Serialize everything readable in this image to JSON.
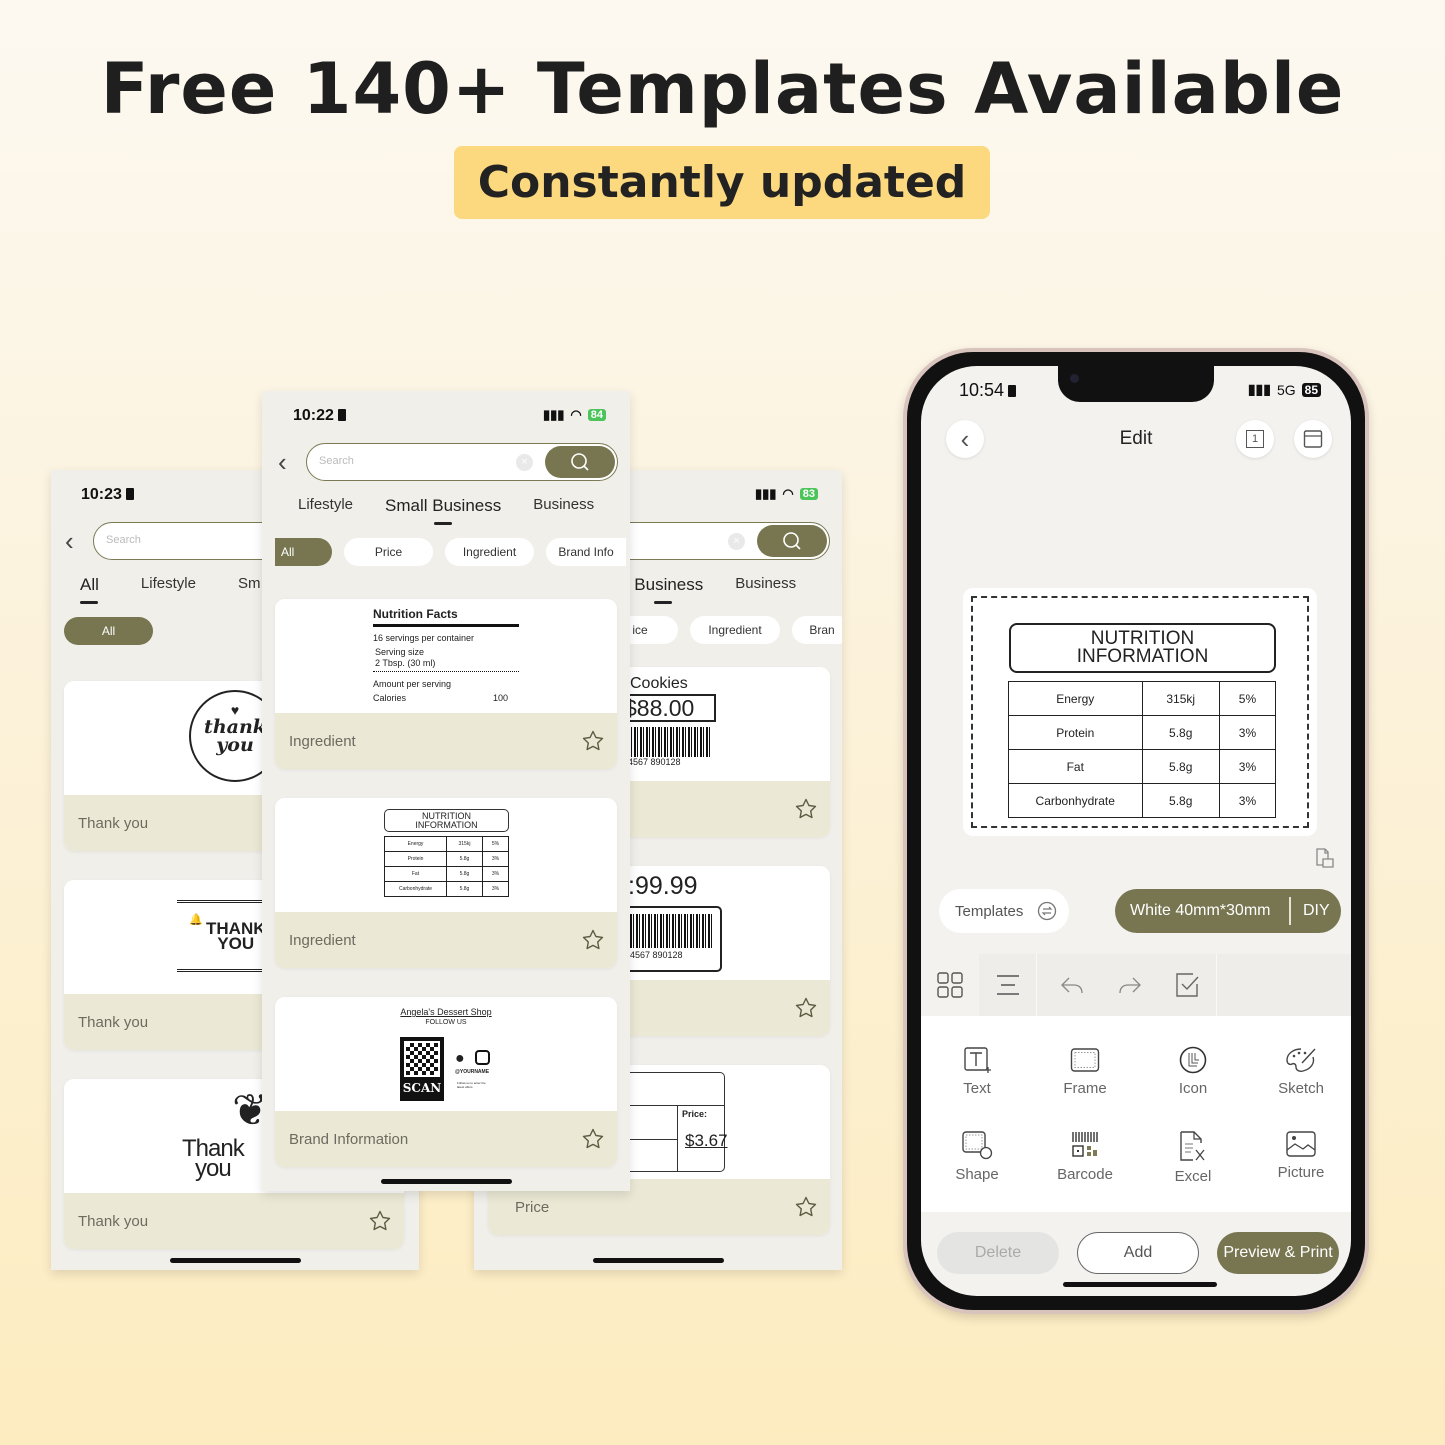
{
  "headline": "Free 140+ Templates Available",
  "badge": "Constantly updated",
  "colors": {
    "accent": "#777650",
    "badge": "#fcd97f",
    "card_footer": "#ebe9d5"
  },
  "left_screen": {
    "time": "10:23",
    "search_placeholder": "Search",
    "tabs": [
      "All",
      "Lifestyle",
      "Sm"
    ],
    "active_tab": "All",
    "chips": [
      "All"
    ],
    "cards": [
      {
        "label": "Thank you",
        "art": "thank you"
      },
      {
        "label": "Thank you",
        "art": "THANK YOU"
      },
      {
        "label": "Thank you",
        "art": "Thank you"
      }
    ],
    "art_thank_1": "thank",
    "art_thank_2": "you",
    "art_caps_1": "THANK",
    "art_caps_2": "YOU",
    "art_script_1": "Thank",
    "art_script_2": "you"
  },
  "middle_screen": {
    "time": "10:22",
    "battery": "84",
    "search_placeholder": "Search",
    "tabs": [
      "Lifestyle",
      "Small Business",
      "Business"
    ],
    "active_tab": "Small Business",
    "chips": [
      "All",
      "Price",
      "Ingredient",
      "Brand Info"
    ],
    "cards": [
      {
        "label": "Ingredient"
      },
      {
        "label": "Ingredient"
      },
      {
        "label": "Brand Information"
      }
    ],
    "nutrition_facts": {
      "title": "Nutrition Facts",
      "servings": "16 servings per container",
      "serving_size_label": "Serving size",
      "serving_size": "2 Tbsp. (30 ml)",
      "amount": "Amount per serving",
      "calories_label": "Calories",
      "calories": "100"
    },
    "brand": {
      "shop": "Angela's Dessert Shop",
      "follow": "FOLLOW US",
      "scan": "SCAN",
      "handle": "@YOURNAME",
      "note": "Follow us to enter the latest offers"
    }
  },
  "right_screen": {
    "battery": "83",
    "tabs": [
      "ll Business",
      "Business"
    ],
    "chips": [
      "ice",
      "Ingredient",
      "Bran"
    ],
    "cards": [
      {
        "label": "",
        "title": "Cookies",
        "price": "$88.00",
        "barcode": "4567  890128"
      },
      {
        "label": "",
        "price": ":99.99",
        "barcode": "4567  890128"
      },
      {
        "label": "Price",
        "price_label": "Price:",
        "price": "$3.67"
      }
    ]
  },
  "nutrition_info": {
    "title_1": "NUTRITION",
    "title_2": "INFORMATION",
    "rows": [
      {
        "name": "Energy",
        "amount": "315kj",
        "pct": "5%"
      },
      {
        "name": "Protein",
        "amount": "5.8g",
        "pct": "3%"
      },
      {
        "name": "Fat",
        "amount": "5.8g",
        "pct": "3%"
      },
      {
        "name": "Carbonhydrate",
        "amount": "5.8g",
        "pct": "3%"
      }
    ]
  },
  "phone": {
    "time": "10:54",
    "network": "5G",
    "battery": "85",
    "title": "Edit",
    "page_indicator": "1",
    "templates_label": "Templates",
    "label_size": "White 40mm*30mm",
    "diy_label": "DIY",
    "tools": [
      "Text",
      "Frame",
      "Icon",
      "Sketch",
      "Shape",
      "Barcode",
      "Excel",
      "Picture"
    ],
    "buttons": {
      "delete": "Delete",
      "add": "Add",
      "preview": "Preview & Print"
    }
  }
}
